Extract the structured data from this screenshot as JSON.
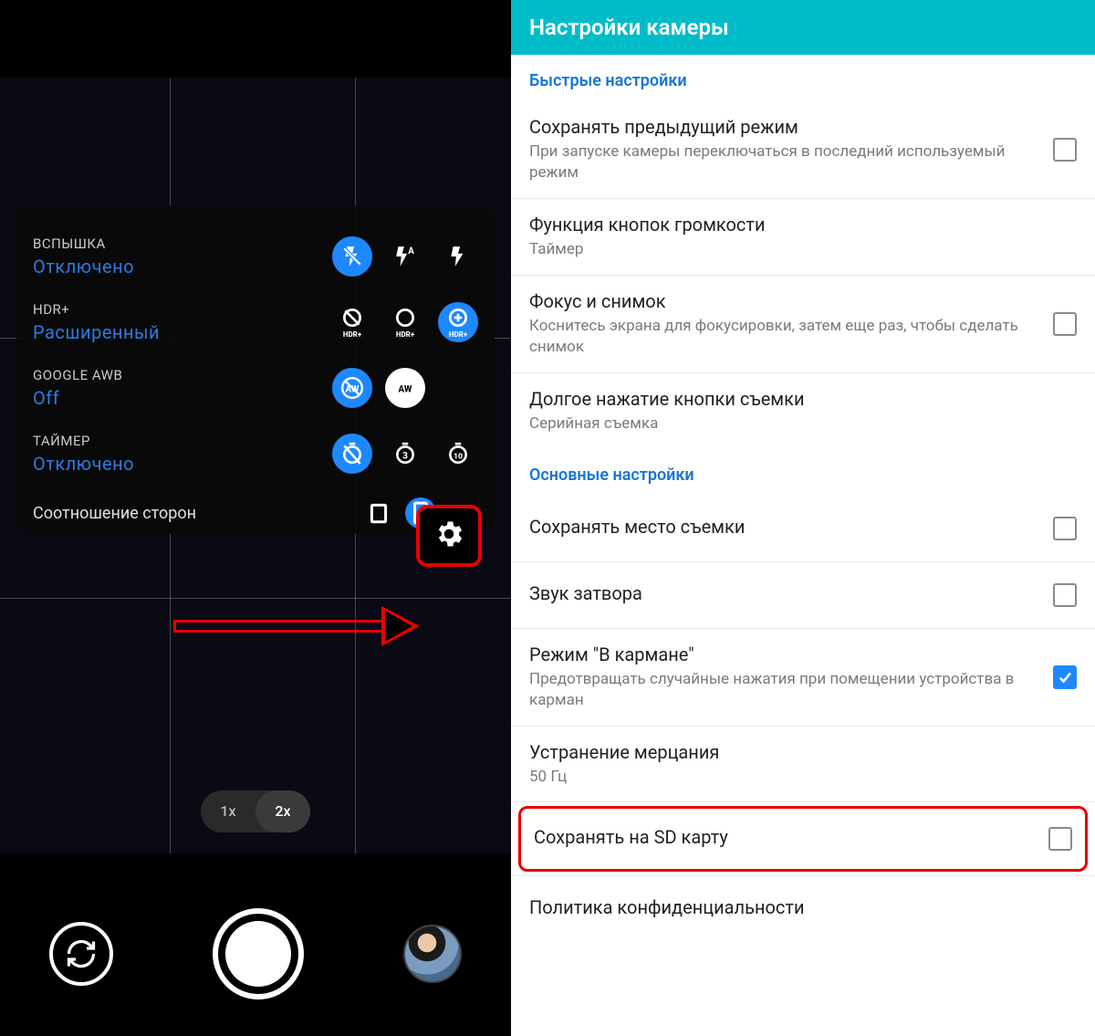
{
  "camera": {
    "quick": {
      "flash": {
        "caption": "ВСПЫШКА",
        "value": "Отключено"
      },
      "hdr": {
        "caption": "HDR+",
        "value": "Расширенный",
        "labels": {
          "off": "HDR+",
          "on": "HDR+",
          "enh": "HDR+"
        }
      },
      "awb": {
        "caption": "GOOGLE AWB",
        "value": "Off"
      },
      "timer": {
        "caption": "ТАЙМЕР",
        "value": "Отключено"
      },
      "aspect": {
        "label": "Соотношение сторон"
      }
    },
    "zoom": {
      "opt1": "1x",
      "opt2": "2x"
    }
  },
  "settings": {
    "title": "Настройки камеры",
    "sections": {
      "quick": "Быстрые настройки",
      "main": "Основные настройки"
    },
    "items": {
      "savePrev": {
        "title": "Сохранять предыдущий режим",
        "sub": "При запуске камеры переключаться в последний используемый режим"
      },
      "volume": {
        "title": "Функция кнопок громкости",
        "sub": "Таймер"
      },
      "focus": {
        "title": "Фокус и снимок",
        "sub": "Коснитесь экрана для фокусировки, затем еще раз, чтобы сделать снимок"
      },
      "longpress": {
        "title": "Долгое нажатие кнопки съемки",
        "sub": "Серийная съемка"
      },
      "location": {
        "title": "Сохранять место съемки"
      },
      "shutterSound": {
        "title": "Звук затвора"
      },
      "pocket": {
        "title": "Режим \"В кармане\"",
        "sub": "Предотвращать случайные нажатия при помещении устройства в карман"
      },
      "flicker": {
        "title": "Устранение мерцания",
        "sub": "50 Гц"
      },
      "sdcard": {
        "title": "Сохранять на SD карту"
      },
      "privacy": {
        "title": "Политика конфиденциальности"
      }
    }
  }
}
